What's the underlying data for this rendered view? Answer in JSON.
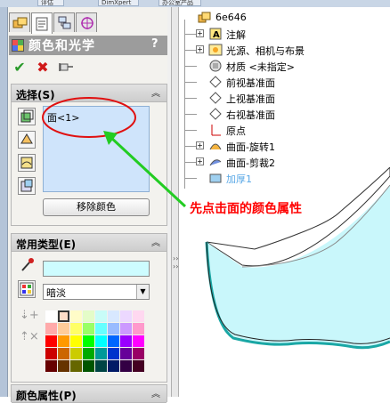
{
  "top_tabs": [
    "评估",
    "DimXpert",
    "办公室产品"
  ],
  "pm_tabs": [
    "feature-manager",
    "property-manager",
    "configuration-manager",
    "dimxpert-manager"
  ],
  "panel": {
    "title": "颜色和光学",
    "help": "?",
    "ok": "✔",
    "cancel": "✖",
    "pin": "pin"
  },
  "selection": {
    "header": "选择(S)",
    "items": [
      "面<1>"
    ],
    "remove_button": "移除颜色"
  },
  "common_types": {
    "header": "常用类型(E)",
    "selected_color": "#cdfcff",
    "dropdown_value": "暗淡",
    "selected_swatch_index": 1,
    "palette": [
      "#ffffff",
      "#fddcc8",
      "#fffcc8",
      "#e4fcc8",
      "#c8fcf8",
      "#d8e8ff",
      "#ecd8ff",
      "#ffd8f0",
      "#ffaaaa",
      "#ffcc99",
      "#ffff66",
      "#99ff66",
      "#66ffff",
      "#99bbff",
      "#cc99ff",
      "#ff99cc",
      "#ff0000",
      "#ff9900",
      "#ffff00",
      "#00ff00",
      "#00ffff",
      "#0066ff",
      "#9900ff",
      "#ff00ff",
      "#cc0000",
      "#cc6600",
      "#cccc00",
      "#00aa00",
      "#009999",
      "#0033cc",
      "#660099",
      "#990066",
      "#660000",
      "#663300",
      "#666600",
      "#005500",
      "#004444",
      "#001a66",
      "#330044",
      "#440022"
    ]
  },
  "color_props": {
    "header": "颜色属性(P)"
  },
  "tree": {
    "root": "6e646",
    "nodes": [
      {
        "label": "注解",
        "expander": "+"
      },
      {
        "label": "光源、相机与布景",
        "expander": "+"
      },
      {
        "label": "材质 <未指定>",
        "expander": ""
      },
      {
        "label": "前视基准面",
        "expander": ""
      },
      {
        "label": "上视基准面",
        "expander": ""
      },
      {
        "label": "右视基准面",
        "expander": ""
      },
      {
        "label": "原点",
        "expander": ""
      },
      {
        "label": "曲面-旋转1",
        "expander": "+"
      },
      {
        "label": "曲面-剪裁2",
        "expander": "+"
      },
      {
        "label": "加厚1",
        "expander": ""
      }
    ]
  },
  "annotation": {
    "text": "先点击面的颜色属性",
    "color": "#ff0000",
    "ellipse_color": "#e01010",
    "arrow_color": "#22cc22"
  },
  "model_colors": {
    "body": "#ffffff",
    "face": "#c9f7fb",
    "edge": "#1aa7a5"
  }
}
